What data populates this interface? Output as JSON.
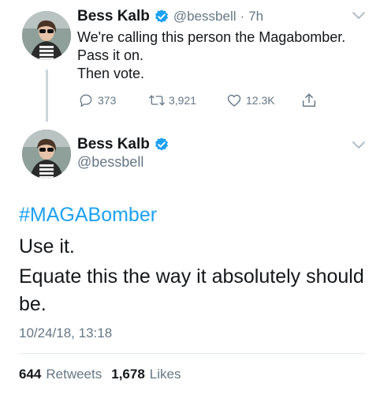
{
  "reply_tweet": {
    "author_name": "Bess Kalb",
    "handle": "@bessbell",
    "separator": "·",
    "time": "7h",
    "text": "We're calling this person the Magabomber.\nPass it on.\nThen vote.",
    "actions": {
      "replies": "373",
      "retweets": "3,921",
      "likes": "12.3K"
    }
  },
  "main_tweet": {
    "author_name": "Bess Kalb",
    "handle": "@bessbell",
    "hashtag": "#MAGABomber",
    "lines": [
      "Use it.",
      "Equate this the way it absolutely should",
      "be."
    ],
    "timestamp": "10/24/18, 13:18",
    "stats": {
      "retweets_count": "644",
      "retweets_label": "Retweets",
      "likes_count": "1,678",
      "likes_label": "Likes"
    }
  },
  "colors": {
    "accent": "#1da1f2",
    "text": "#14171a",
    "muted": "#657786",
    "divider": "#e1e8ed"
  },
  "icons": [
    "verified-badge-icon",
    "chevron-down-icon",
    "reply-icon",
    "retweet-icon",
    "like-icon",
    "share-icon"
  ]
}
